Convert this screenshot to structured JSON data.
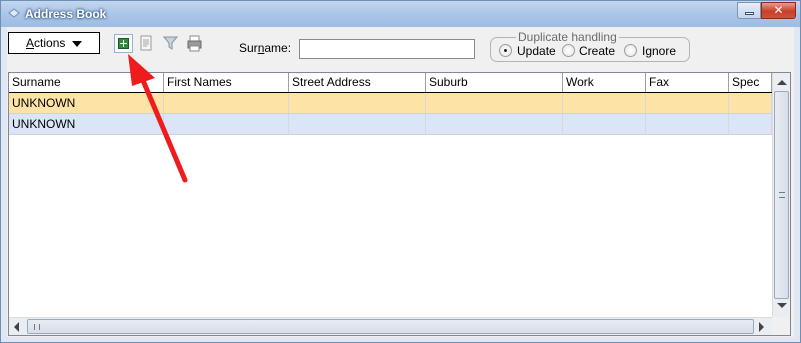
{
  "window": {
    "title": "Address Book",
    "close_glyph": "✕"
  },
  "toolbar": {
    "actions_label_prefix": "A",
    "actions_label_rest": "ctions",
    "icons": [
      "add-icon",
      "document-icon",
      "filter-icon",
      "print-icon"
    ]
  },
  "search": {
    "surname_label_pre": "Sur",
    "surname_label_underline": "n",
    "surname_label_post": "ame:",
    "surname_value": ""
  },
  "duplicate_handling": {
    "legend": "Duplicate handling",
    "options": [
      {
        "label": "Update",
        "selected": true
      },
      {
        "label": "Create",
        "selected": false
      },
      {
        "label": "Ignore",
        "selected": false
      }
    ]
  },
  "grid": {
    "columns": [
      "Surname",
      "First Names",
      "Street Address",
      "Suburb",
      "Work",
      "Fax",
      "Spec"
    ],
    "rows": [
      {
        "surname": "UNKNOWN",
        "first_names": "",
        "street_address": "",
        "suburb": "",
        "work": "",
        "fax": "",
        "spec": ""
      },
      {
        "surname": "UNKNOWN",
        "first_names": "",
        "street_address": "",
        "suburb": "",
        "work": "",
        "fax": "",
        "spec": ""
      }
    ]
  },
  "colors": {
    "selected_row": "#fde3a5",
    "alt_row": "#dae6f7",
    "annotation_arrow": "#ee1c1c",
    "add_button": "#2f8d3a"
  }
}
